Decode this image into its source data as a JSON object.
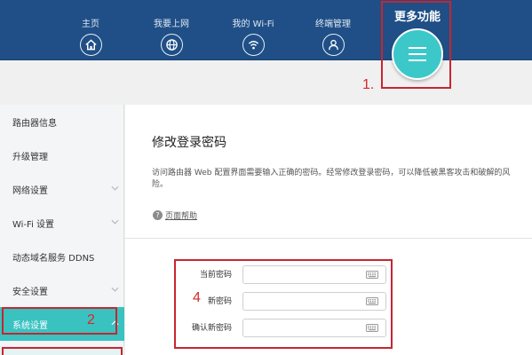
{
  "header": {
    "nav": [
      {
        "label": "主页",
        "icon": "home-icon"
      },
      {
        "label": "我要上网",
        "icon": "globe-icon"
      },
      {
        "label": "我的 Wi-Fi",
        "icon": "wifi-icon"
      },
      {
        "label": "终端管理",
        "icon": "user-icon"
      }
    ],
    "more": {
      "label": "更多功能",
      "icon": "menu-icon"
    }
  },
  "annotations": {
    "one": "1.",
    "two": "2",
    "four": "4"
  },
  "sidebar": {
    "items": [
      {
        "label": "路由器信息",
        "chevron": false
      },
      {
        "label": "升级管理",
        "chevron": false
      },
      {
        "label": "网络设置",
        "chevron": true
      },
      {
        "label": "Wi-Fi 设置",
        "chevron": true
      },
      {
        "label": "动态域名服务 DDNS",
        "chevron": false
      },
      {
        "label": "安全设置",
        "chevron": true
      },
      {
        "label": "系统设置",
        "chevron": true,
        "active": true
      }
    ]
  },
  "content": {
    "title": "修改登录密码",
    "description": "访问路由器 Web 配置界面需要输入正确的密码。经常修改登录密码，可以降低被黑客攻击和破解的风险。",
    "help": "页面帮助",
    "fields": [
      {
        "label": "当前密码",
        "value": ""
      },
      {
        "label": "新密码",
        "value": ""
      },
      {
        "label": "确认新密码",
        "value": ""
      }
    ]
  },
  "colors": {
    "header": "#1f4f86",
    "accent": "#39c2c0",
    "annotation": "#c62630"
  }
}
